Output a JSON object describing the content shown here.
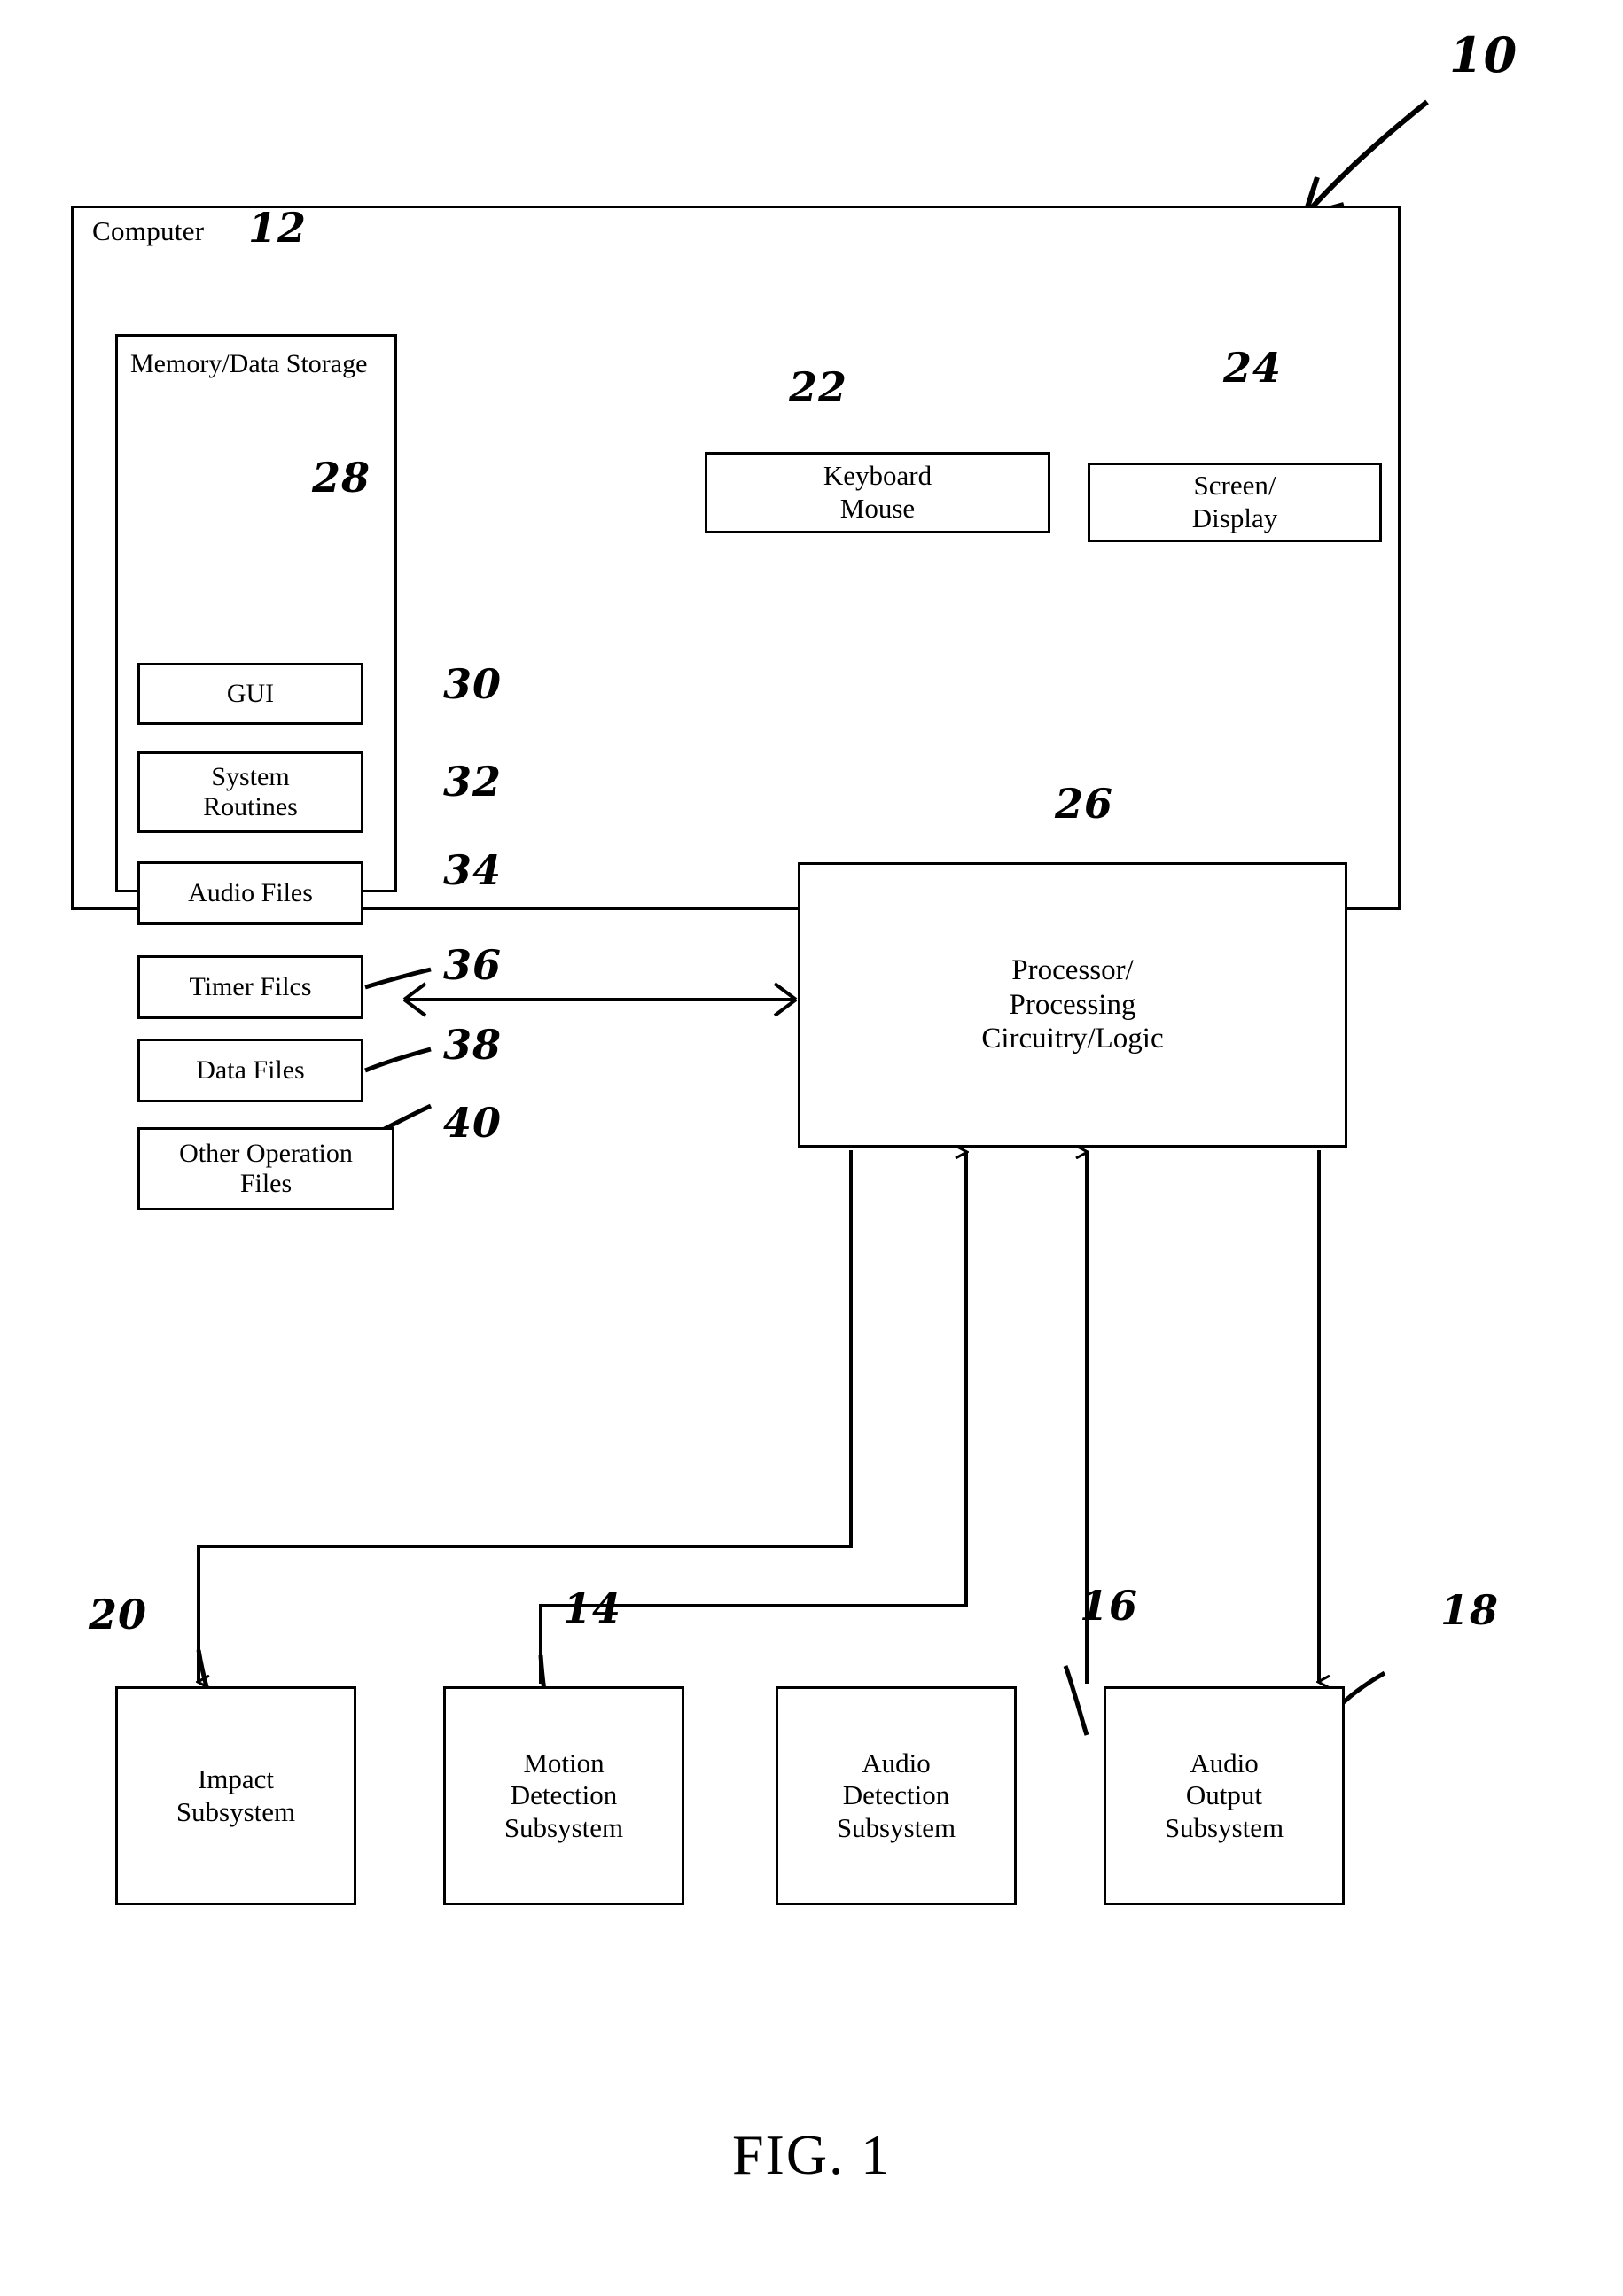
{
  "figure": {
    "caption": "FIG. 1",
    "system_ref": "10"
  },
  "computer": {
    "label": "Computer",
    "ref": "12"
  },
  "memory": {
    "label": "Memory/Data Storage",
    "ref": "28",
    "items": [
      {
        "label": "GUI",
        "ref": "30"
      },
      {
        "label": "System\nRoutines",
        "ref": "32"
      },
      {
        "label": "Audio Files",
        "ref": "34"
      },
      {
        "label": "Timer Filcs",
        "ref": "36"
      },
      {
        "label": "Data Files",
        "ref": "38"
      },
      {
        "label": "Other Operation\nFiles",
        "ref": "40"
      }
    ]
  },
  "input_device": {
    "label": "Keyboard\nMouse",
    "ref": "22"
  },
  "display_device": {
    "label": "Screen/\nDisplay",
    "ref": "24"
  },
  "processor": {
    "label": "Processor/\nProcessing\nCircuitry/Logic",
    "ref": "26"
  },
  "subsystems": [
    {
      "label": "Impact\nSubsystem",
      "ref": "20"
    },
    {
      "label": "Motion\nDetection\nSubsystem",
      "ref": "14"
    },
    {
      "label": "Audio\nDetection\nSubsystem",
      "ref": "16"
    },
    {
      "label": "Audio\nOutput\nSubsystem",
      "ref": "18"
    }
  ]
}
